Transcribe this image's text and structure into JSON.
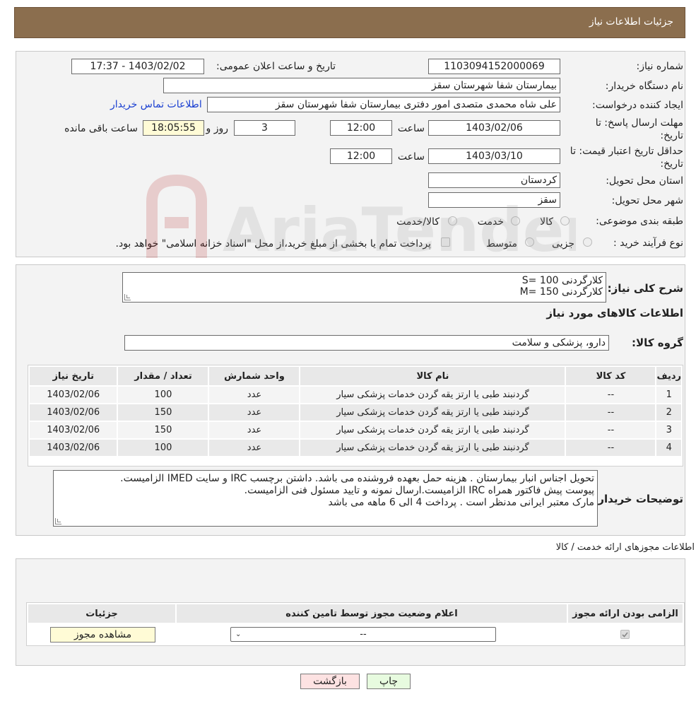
{
  "header": {
    "title": "جزئیات اطلاعات نیاز"
  },
  "form": {
    "need_number_label": "شماره نیاز:",
    "need_number": "1103094152000069",
    "announce_label": "تاریخ و ساعت اعلان عمومی:",
    "announce_value": "1403/02/02 - 17:37",
    "buyer_org_label": "نام دستگاه خریدار:",
    "buyer_org": "بیمارستان شفا شهرستان سقز",
    "requester_label": "ایجاد کننده درخواست:",
    "requester": "علی شاه محمدی متصدی امور دفتری بیمارستان شفا شهرستان سقز",
    "contact_link": "اطلاعات تماس خریدار",
    "deadline_label_1": "مهلت ارسال پاسخ: تا",
    "deadline_label_2": "تاریخ:",
    "deadline_date": "1403/02/06",
    "time_label": "ساعت",
    "deadline_time": "12:00",
    "days_value": "3",
    "days_label": "روز و",
    "remaining_time": "18:05:55",
    "remaining_label": "ساعت باقی مانده",
    "validity_label_1": "حداقل تاریخ اعتبار قیمت: تا",
    "validity_label_2": "تاریخ:",
    "validity_date": "1403/03/10",
    "validity_time": "12:00",
    "province_label": "استان محل تحویل:",
    "province": "کردستان",
    "city_label": "شهر محل تحویل:",
    "city": "سقز",
    "category_label": "طبقه بندی موضوعی:",
    "category_options": [
      "کالا",
      "خدمت",
      "کالا/خدمت"
    ],
    "process_label": "نوع فرآیند خرید :",
    "process_options": [
      "جزیی",
      "متوسط"
    ],
    "payment_note": "پرداخت تمام یا بخشی از مبلغ خرید،از محل \"اسناد خزانه اسلامی\" خواهد بود."
  },
  "description": {
    "label": "شرح کلی نیاز:",
    "lines": [
      "کلارگردنی 100 =S",
      "کلارگردنی 150 =M"
    ]
  },
  "goods": {
    "section_title": "اطلاعات کالاهای مورد نیاز",
    "group_label": "گروه کالا:",
    "group_value": "دارو، پزشکی و سلامت",
    "columns": [
      "ردیف",
      "کد کالا",
      "نام کالا",
      "واحد شمارش",
      "تعداد / مقدار",
      "تاریخ نیاز"
    ],
    "rows": [
      [
        "1",
        "--",
        "گردنبند طبی یا ارتز یقه گردن خدمات پزشکی سیار",
        "عدد",
        "100",
        "1403/02/06"
      ],
      [
        "2",
        "--",
        "گردنبند طبی یا ارتز یقه گردن خدمات پزشکی سیار",
        "عدد",
        "150",
        "1403/02/06"
      ],
      [
        "3",
        "--",
        "گردنبند طبی یا ارتز یقه گردن خدمات پزشکی سیار",
        "عدد",
        "150",
        "1403/02/06"
      ],
      [
        "4",
        "--",
        "گردنبند طبی یا ارتز یقه گردن خدمات پزشکی سیار",
        "عدد",
        "100",
        "1403/02/06"
      ]
    ]
  },
  "buyer_notes": {
    "label": "توضیحات خریدار:",
    "lines": [
      "تحویل اجناس  انبار بیمارستان . هزینه حمل بعهده فروشنده می باشد.  داشتن برچسب  IRC  و سایت  IMED  الزامیست.",
      "پیوست پیش فاکتور همراه IRC  الزامیست.ارسال نمونه و تایید مسئول فنی الزامیست.",
      "مارک معتبر ایرانی مدنظر است . پرداخت 4 الی 6 ماهه می باشد"
    ]
  },
  "permits": {
    "section_title": "اطلاعات مجوزهای ارائه خدمت / کالا",
    "columns": [
      "الزامی بودن ارائه مجوز",
      "اعلام وضعیت مجوز توسط تامین کننده",
      "جزئیات"
    ],
    "select_value": "--",
    "view_button": "مشاهده مجوز"
  },
  "footer": {
    "print": "چاپ",
    "back": "بازگشت"
  },
  "watermark_text": "AriaTender.neT"
}
